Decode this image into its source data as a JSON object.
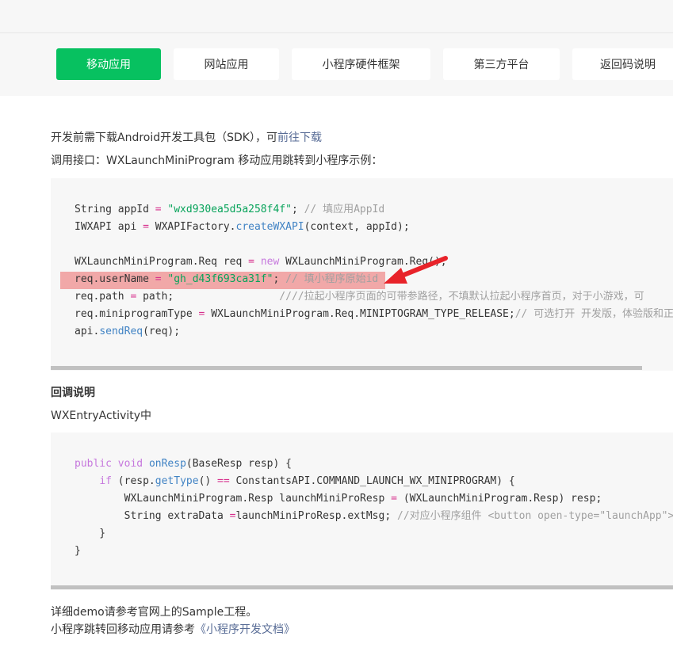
{
  "tabs": [
    {
      "label": "移动应用",
      "active": true
    },
    {
      "label": "网站应用",
      "active": false
    },
    {
      "label": "小程序硬件框架",
      "active": false
    },
    {
      "label": "第三方平台",
      "active": false
    },
    {
      "label": "返回码说明",
      "active": false
    }
  ],
  "intro": {
    "sdk_text": "开发前需下载Android开发工具包（SDK），可",
    "sdk_link": "前往下载",
    "api_text": "调用接口：WXLaunchMiniProgram 移动应用跳转到小程序示例："
  },
  "code1": {
    "line1": [
      "String appId ",
      "=",
      " ",
      "\"wxd930ea5d5a258f4f\"",
      "; ",
      "// 填应用AppId"
    ],
    "line2": [
      "IWXAPI api ",
      "=",
      " WXAPIFactory.",
      "createWXAPI",
      "(context, appId);"
    ],
    "line3": [
      "WXLaunchMiniProgram.Req req ",
      "=",
      " ",
      "new",
      " WXLaunchMiniProgram.Req();"
    ],
    "line4": [
      "req.userName ",
      "=",
      " ",
      "\"gh_d43f693ca31f\"",
      "; ",
      "// 填小程序原始id"
    ],
    "line5": [
      "req.path ",
      "=",
      " path;                 ",
      "////拉起小程序页面的可带参路径，不填默认拉起小程序首页，对于小游戏，可"
    ],
    "line6": [
      "req.miniprogramType ",
      "=",
      " WXLaunchMiniProgram.Req.MINIPTOGRAM_TYPE_RELEASE;",
      "// 可选打开 开发版，体验版和正"
    ],
    "line7": [
      "api.",
      "sendReq",
      "(req);"
    ]
  },
  "callback": {
    "heading": "回调说明",
    "subheading": "WXEntryActivity中"
  },
  "code2": {
    "line1": [
      "public",
      " ",
      "void",
      " ",
      "onResp",
      "(BaseResp resp) {"
    ],
    "line2": [
      "    ",
      "if",
      " (resp.",
      "getType",
      "() ",
      "==",
      " ConstantsAPI.COMMAND_LAUNCH_WX_MINIPROGRAM) {"
    ],
    "line3": [
      "        WXLaunchMiniProgram.Resp launchMiniProResp ",
      "=",
      " (WXLaunchMiniProgram.Resp) resp;"
    ],
    "line4": [
      "        String extraData ",
      "=",
      "launchMiniProResp.extMsg; ",
      "//对应小程序组件 <button open-type=\"launchApp\">"
    ],
    "line5": [
      "    }"
    ],
    "line6": [
      "}"
    ]
  },
  "footer": {
    "demo_text": "详细demo请参考官网上的Sample工程。",
    "doc_text": "小程序跳转回移动应用请参考",
    "doc_link": "《小程序开发文档》"
  },
  "colors": {
    "accent": "#07c160",
    "link": "#576b95",
    "highlight": "#ef8d8d",
    "annotation_arrow": "#e8232a"
  }
}
